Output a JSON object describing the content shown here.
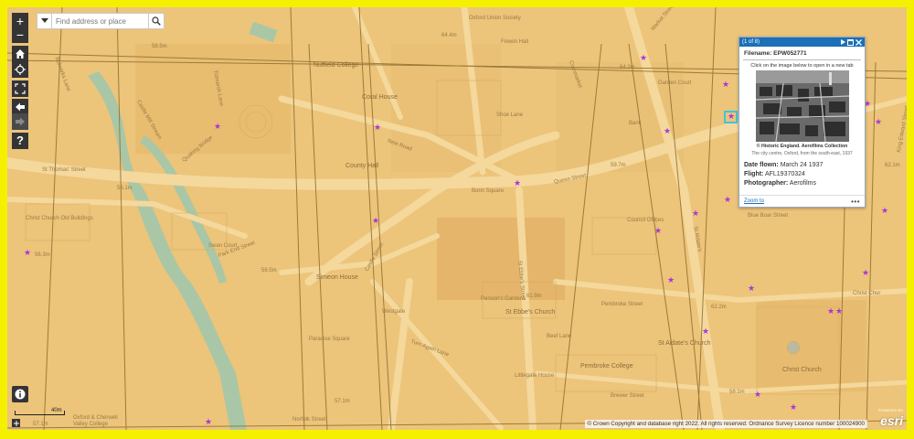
{
  "search": {
    "placeholder": "Find address or place"
  },
  "controls": {
    "zoom_in": "+",
    "zoom_out": "−",
    "help": "?"
  },
  "popup": {
    "counter": "(1 of 8)",
    "title": "Filename: EPW052771",
    "instruction": "Click on the image below to open in a new tab",
    "credit": "© Historic England. Aerofilms Collection",
    "caption": "The city centre, Oxford, from the south-east, 1937",
    "attributes": [
      {
        "label": "Date flown:",
        "value": "March 24 1937"
      },
      {
        "label": "Flight:",
        "value": "AFL19370324"
      },
      {
        "label": "Photographer:",
        "value": "Aerofilms"
      }
    ],
    "zoom_to": "Zoom to",
    "more": "•••"
  },
  "attribution": "© Crown Copyright and database right 2022. All rights reserved. Ordnance Survey Licence number 100024900",
  "logo": {
    "text": "esri",
    "small": "POWERED BY"
  },
  "scale": {
    "label": "40m"
  },
  "map_labels": [
    "58.5m",
    "Nuffield College",
    "Oxford Union Society",
    "Frewin Hall",
    "Market Street",
    "64.4m",
    "Coral House",
    "County Hall",
    "Bank",
    "Cornmarket",
    "Garden Court",
    "New Road",
    "Queen Street",
    "Bonn Square",
    "Park End Street",
    "Quaking Bridge",
    "Castle Mill Stream",
    "Christ Church Old Buildings",
    "Swan Court",
    "Simeon House",
    "Norfolk Street",
    "Paradise Square",
    "St Ebbe's Street",
    "Penson's Gardens",
    "St Ebbe's Church",
    "Beef Lane",
    "Pembroke Street",
    "St Aldate's Church",
    "Pembroke College",
    "Littlegate House",
    "Turn Again Lane",
    "Brewer Street",
    "Christ Church",
    "Council Offices",
    "Blue Boar Street",
    "St Aldate's",
    "Oxford & Cherwell Valley College",
    "Castle Street",
    "Shoe Lane",
    "St Thomas' Street",
    "Bulwarks Lane",
    "Tidmarsh Lane",
    "Christ Chur",
    "Westgate",
    "King Edward Street",
    "57.1m",
    "58.1m",
    "62.1m",
    "64.2m",
    "61.9m",
    "62.2m",
    "56.3m",
    "56.1m",
    "59.7m",
    "58.5m",
    "57.1m"
  ],
  "markers": [
    "marker",
    "marker",
    "marker",
    "marker",
    "marker",
    "marker",
    "marker",
    "marker",
    "marker",
    "marker",
    "marker",
    "marker",
    "marker",
    "marker",
    "marker",
    "marker",
    "marker",
    "marker",
    "marker",
    "marker",
    "marker",
    "marker",
    "marker",
    "marker"
  ],
  "colors": {
    "background": "#ecc47a",
    "road": "#f4d89c",
    "water": "#a9c7a6",
    "marker": "#a935d9",
    "popup_header": "#1b70b8",
    "frame_border": "#f5f000"
  }
}
